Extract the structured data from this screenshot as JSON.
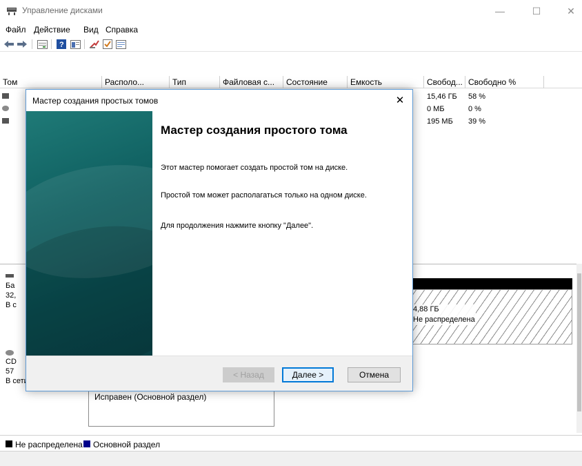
{
  "window": {
    "title": "Управление дисками",
    "minimize": "—",
    "maximize": "☐",
    "close": "✕"
  },
  "menu": [
    "Файл",
    "Действие",
    "Вид",
    "Справка"
  ],
  "toolbar": {
    "icons": [
      "back-icon",
      "forward-icon",
      "disk-list-icon",
      "help-icon",
      "properties-icon",
      "rescan-icon",
      "check-icon",
      "settings-icon"
    ]
  },
  "volumes": {
    "columns": [
      "Том",
      "Располо...",
      "Тип",
      "Файловая с...",
      "Состояние",
      "Емкость",
      "Свобод...",
      "Свободно %"
    ],
    "rows": [
      {
        "free": "15,46 ГБ",
        "free_pct": "58 %"
      },
      {
        "free": "0 МБ",
        "free_pct": "0 %"
      },
      {
        "free": "195 МБ",
        "free_pct": "39 %"
      }
    ]
  },
  "disks": {
    "disk0": {
      "line1": "Ба",
      "line2": "32,",
      "line3": "В с"
    },
    "disk0_unallocated": {
      "size": "4,88 ГБ",
      "status": "Не распределена"
    },
    "cdrom": {
      "line1": "CD",
      "line2": "57",
      "line3": "В сети"
    },
    "cdrom_partition": {
      "status": "Исправен (Основной раздел)"
    }
  },
  "legend": {
    "unallocated": "Не распределена",
    "primary": "Основной раздел",
    "colors": {
      "unallocated": "#000000",
      "primary": "#00008b"
    }
  },
  "dialog": {
    "title": "Мастер создания простых томов",
    "close": "✕",
    "heading": "Мастер создания простого тома",
    "para1": "Этот мастер помогает создать простой том на диске.",
    "para2": "Простой том может располагаться только на одном диске.",
    "para3": "Для продолжения нажмите кнопку \"Далее\".",
    "back_label": "< Назад",
    "next_label": "Далее >",
    "cancel_label": "Отмена",
    "accent_color": "#0078d7"
  }
}
